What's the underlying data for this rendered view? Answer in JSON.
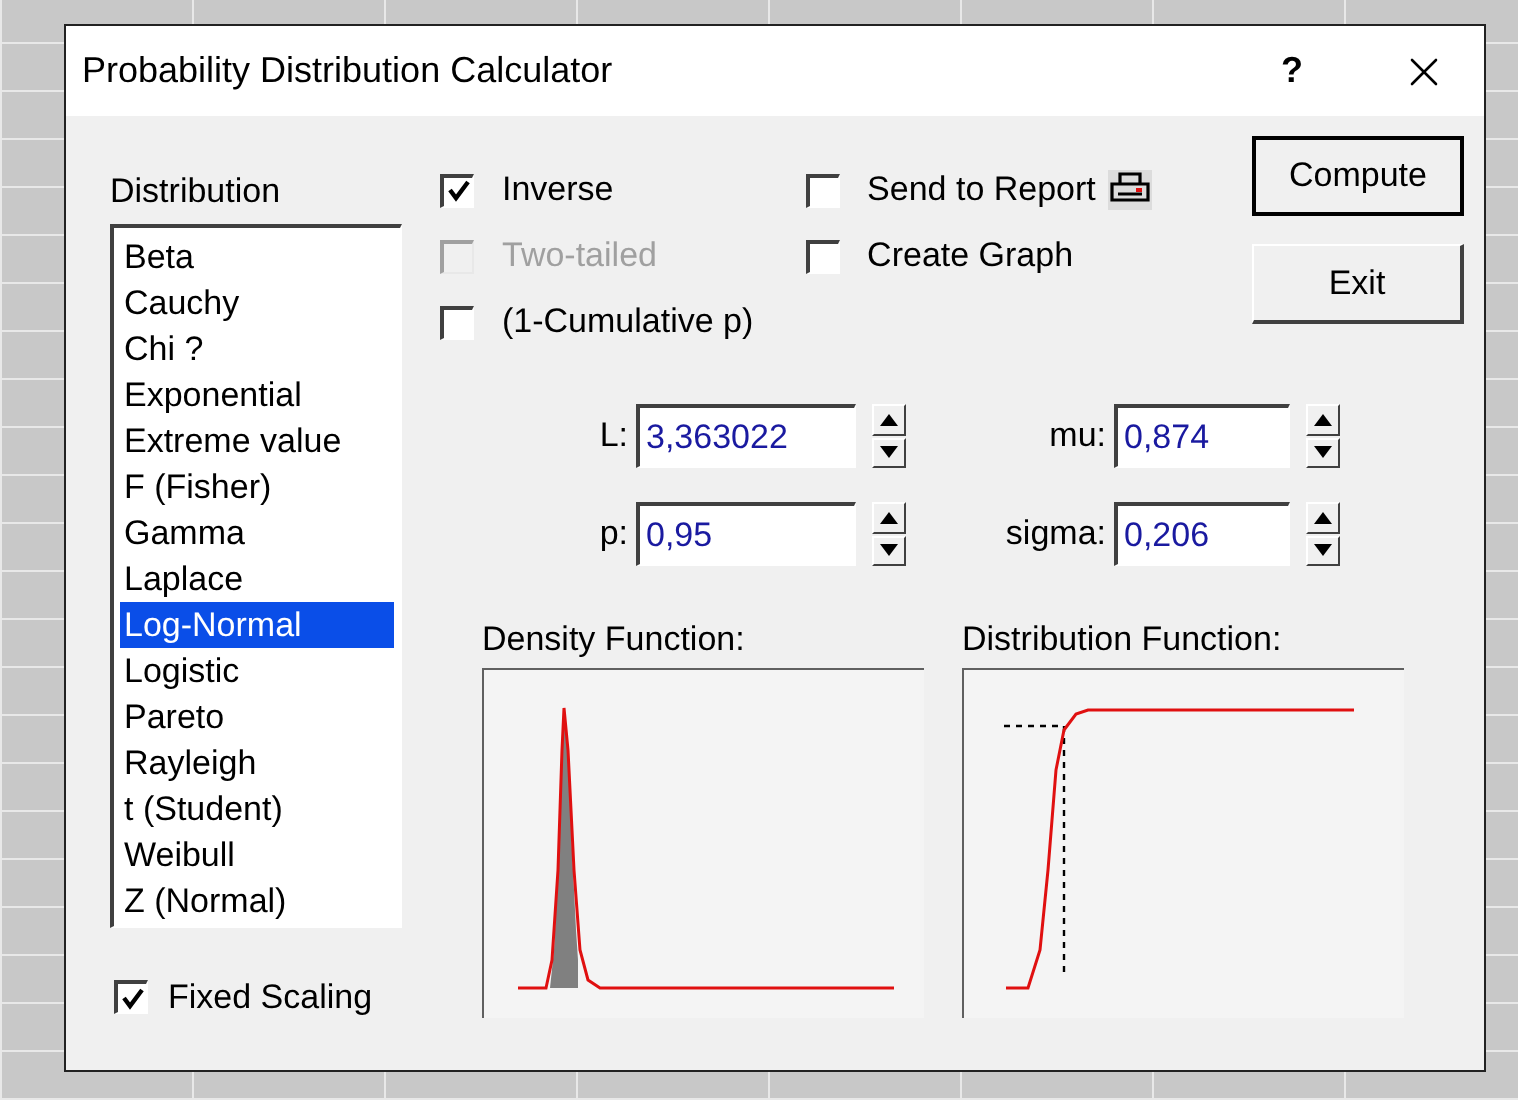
{
  "window": {
    "title": "Probability Distribution Calculator",
    "help": "?"
  },
  "distribution": {
    "label": "Distribution",
    "items": [
      {
        "label": "Beta",
        "selected": false
      },
      {
        "label": "Cauchy",
        "selected": false
      },
      {
        "label": "Chi ?",
        "selected": false
      },
      {
        "label": "Exponential",
        "selected": false
      },
      {
        "label": "Extreme value",
        "selected": false
      },
      {
        "label": "F (Fisher)",
        "selected": false
      },
      {
        "label": "Gamma",
        "selected": false
      },
      {
        "label": "Laplace",
        "selected": false
      },
      {
        "label": "Log-Normal",
        "selected": true
      },
      {
        "label": "Logistic",
        "selected": false
      },
      {
        "label": "Pareto",
        "selected": false
      },
      {
        "label": "Rayleigh",
        "selected": false
      },
      {
        "label": "t (Student)",
        "selected": false
      },
      {
        "label": "Weibull",
        "selected": false
      },
      {
        "label": "Z (Normal)",
        "selected": false
      }
    ]
  },
  "options_left": [
    {
      "label": "Inverse",
      "checked": true,
      "disabled": false
    },
    {
      "label": "Two-tailed",
      "checked": false,
      "disabled": true
    },
    {
      "label": "(1-Cumulative p)",
      "checked": false,
      "disabled": false
    }
  ],
  "options_right": [
    {
      "label": "Send to Report",
      "checked": false,
      "kind": "report"
    },
    {
      "label": "Create Graph",
      "checked": false,
      "kind": "plain"
    }
  ],
  "buttons": [
    {
      "label": "Compute",
      "default": true
    },
    {
      "label": "Exit",
      "default": false
    }
  ],
  "parameters": [
    {
      "label": "L:",
      "value": "3,363022"
    },
    {
      "label": "mu:",
      "value": "0,874"
    },
    {
      "label": "p:",
      "value": "0,95"
    },
    {
      "label": "sigma:",
      "value": "0,206"
    }
  ],
  "plots": [
    {
      "title": "Density Function:",
      "kind": "density"
    },
    {
      "title": "Distribution Function:",
      "kind": "distribution"
    }
  ],
  "fixed_scaling": {
    "label": "Fixed Scaling",
    "checked": true
  }
}
